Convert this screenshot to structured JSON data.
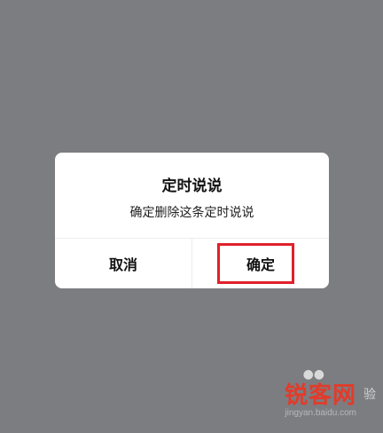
{
  "dialog": {
    "title": "定时说说",
    "message": "确定删除这条定时说说",
    "cancel_label": "取消",
    "confirm_label": "确定"
  },
  "watermark": {
    "main": "锐客网",
    "sub": "jingyan.baidu.com",
    "ghost": "验"
  },
  "colors": {
    "overlay": "#7c7d81",
    "highlight": "#e0202a",
    "watermark": "#e23b2a"
  }
}
